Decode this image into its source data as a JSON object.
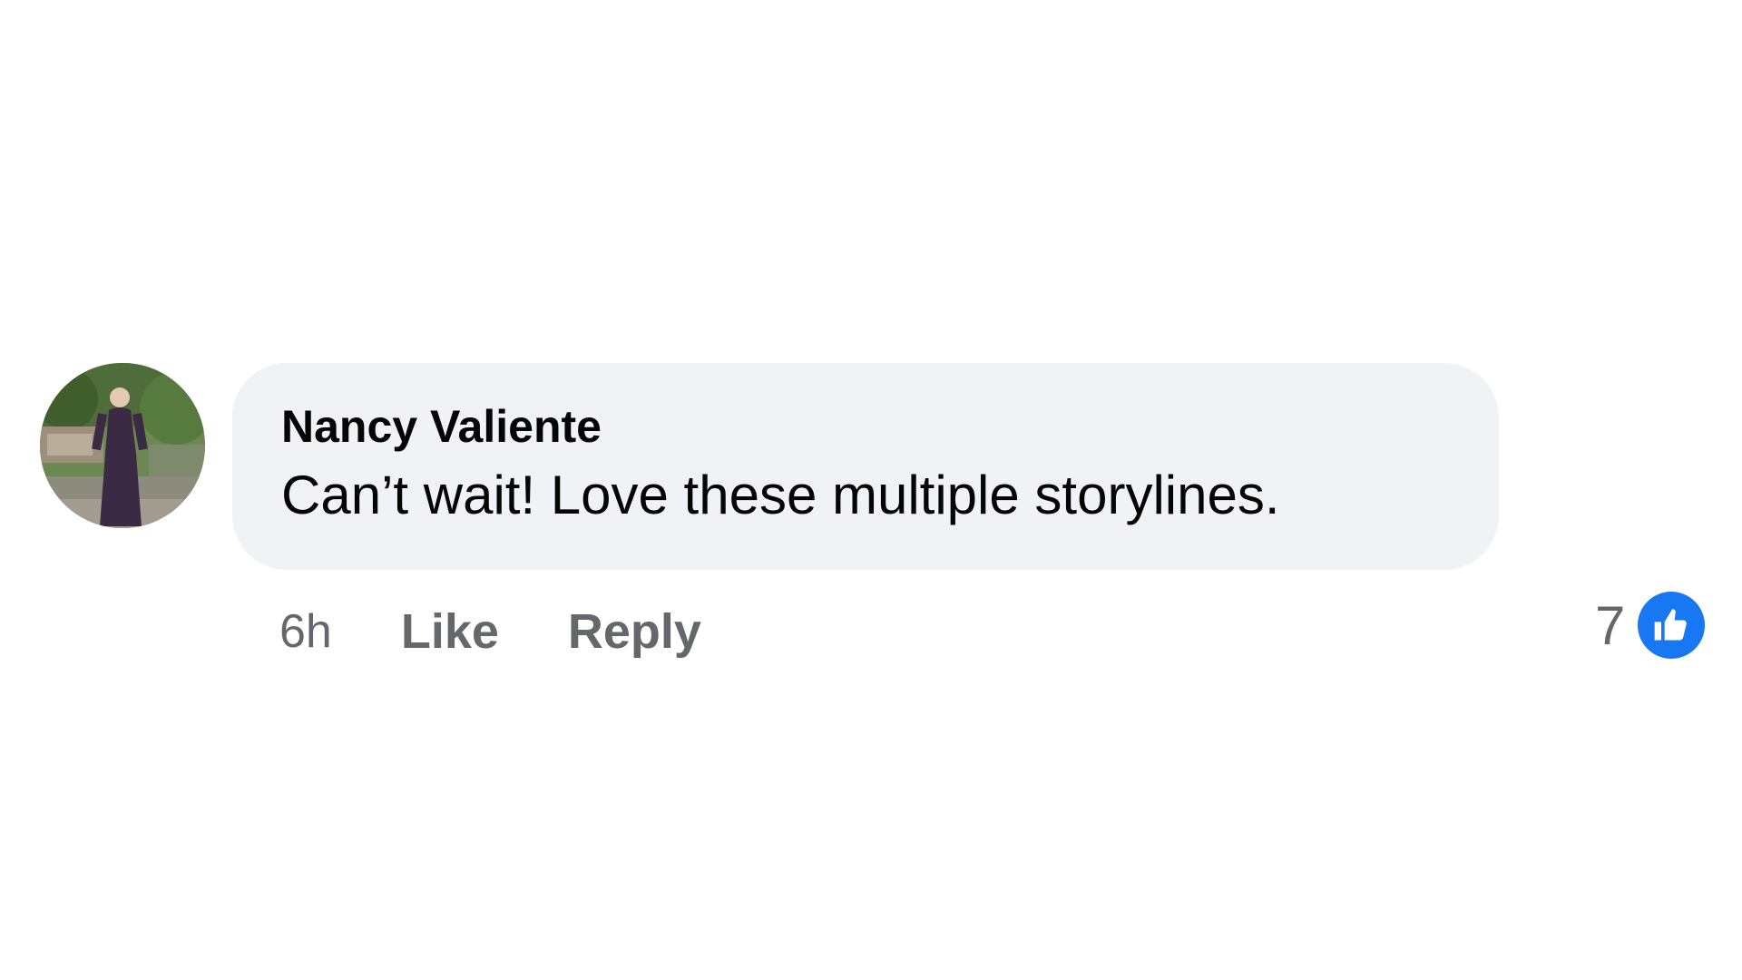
{
  "comment": {
    "author": "Nancy Valiente",
    "text": "Can’t wait! Love these multiple storylines.",
    "avatar_icon": "profile-photo",
    "timestamp": "6h",
    "like_label": "Like",
    "reply_label": "Reply",
    "reaction_count": "7",
    "reaction_icon": "like-reaction-icon",
    "colors": {
      "bubble": "#f0f2f5",
      "secondary_text": "#65676b",
      "like_blue": "#1877f2"
    }
  }
}
